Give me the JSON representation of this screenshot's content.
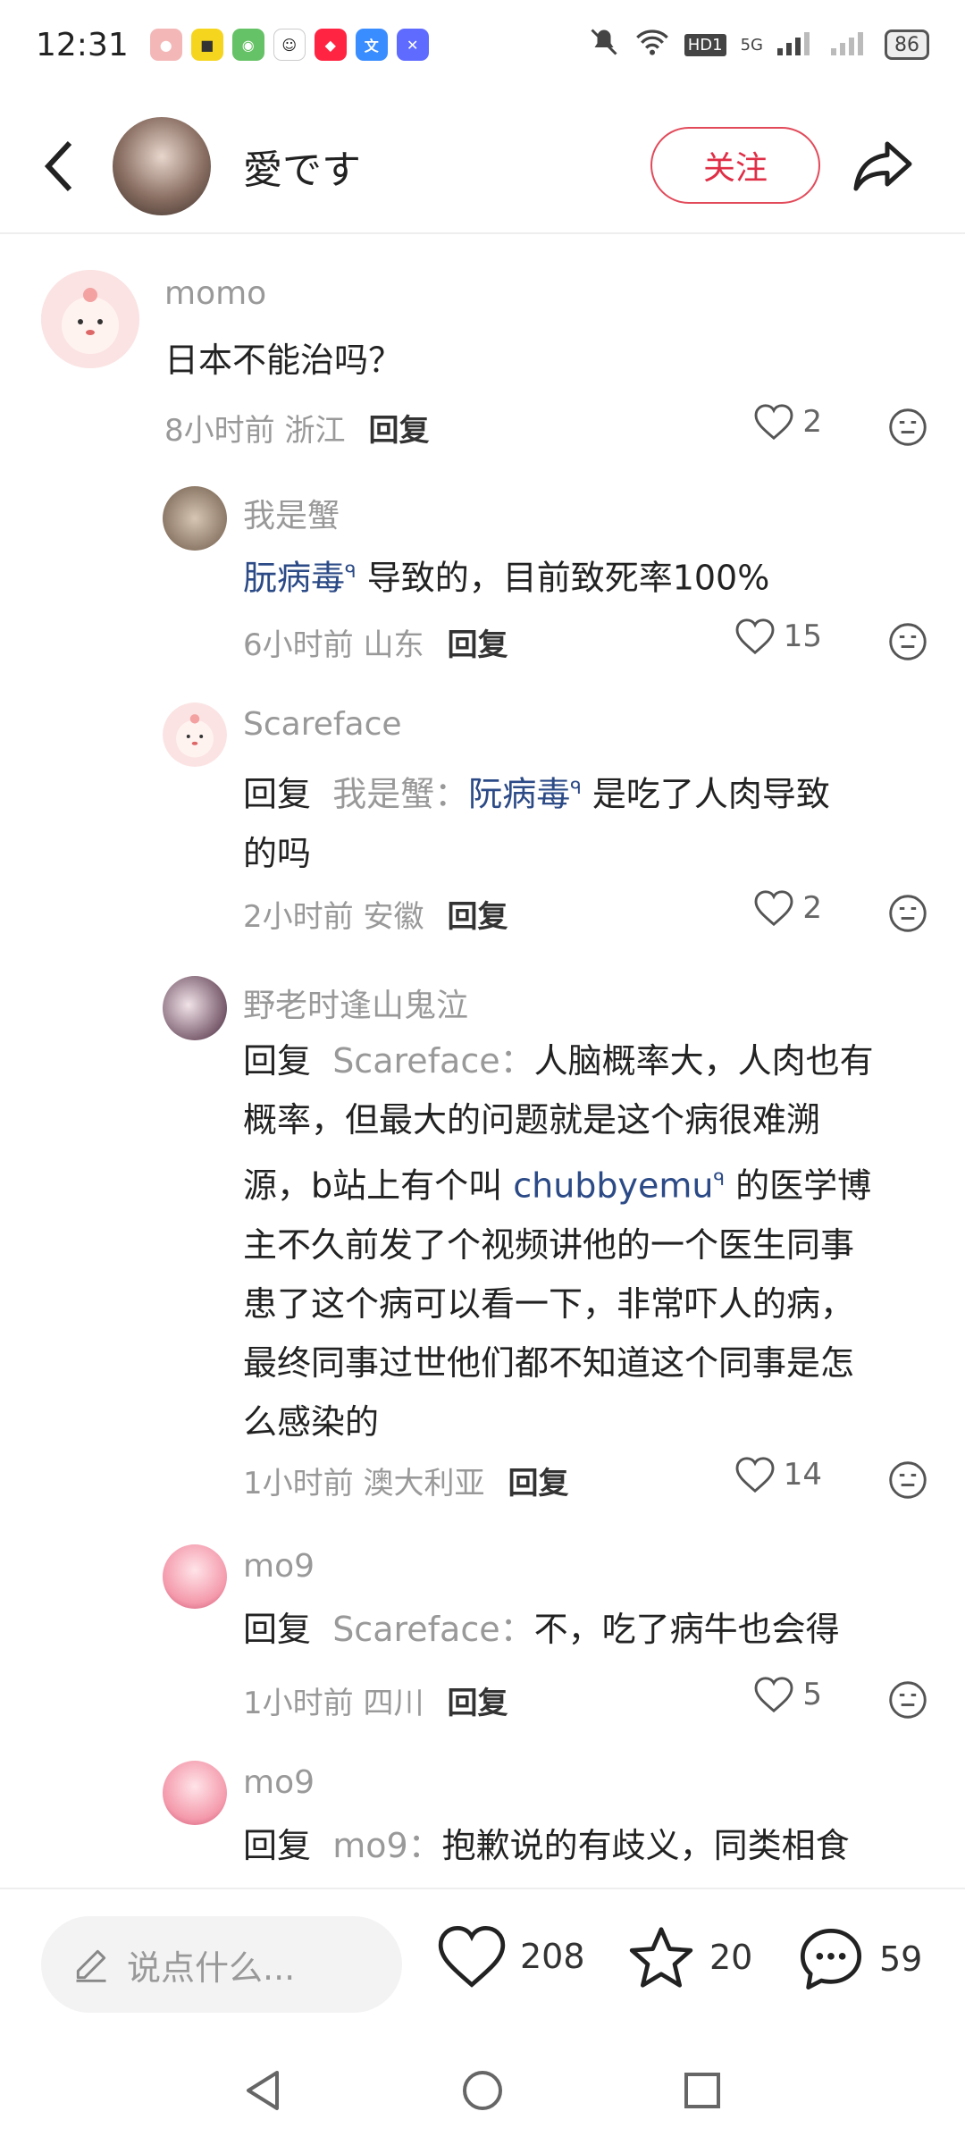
{
  "status_bar": {
    "time": "12:31",
    "network_label": "HD1",
    "signal_label": "5G",
    "battery": "86"
  },
  "header": {
    "username": "愛です",
    "follow_label": "关注"
  },
  "comments": [
    {
      "user": "momo",
      "text": "日本不能治吗？",
      "time": "8小时前",
      "location": "浙江",
      "reply_label": "回复",
      "likes": "2"
    },
    {
      "user": "我是蟹",
      "link_text": "朊病毒",
      "text_after": "导致的，目前致死率100%",
      "time": "6小时前",
      "location": "山东",
      "reply_label": "回复",
      "likes": "15"
    },
    {
      "user": "Scareface",
      "prefix": "回复",
      "reply_to": "我是蟹：",
      "link_text": "阮病毒",
      "text_after_line1": "是吃了人肉导致",
      "text_line2": "的吗",
      "time": "2小时前",
      "location": "安徽",
      "reply_label": "回复",
      "likes": "2"
    },
    {
      "user": "野老时逢山鬼泣",
      "prefix": "回复",
      "reply_to": "Scareface：",
      "line1_rest": "人脑概率大，人肉也有",
      "line2": "概率，但最大的问题就是这个病很难溯",
      "line3_before": "源，b站上有个叫",
      "link_text": "chubbyemu",
      "line3_after": "的医学博",
      "line4": "主不久前发了个视频讲他的一个医生同事",
      "line5": "患了这个病可以看一下，非常吓人的病，",
      "line6": "最终同事过世他们都不知道这个同事是怎",
      "line7": "么感染的",
      "time": "1小时前",
      "location": "澳大利亚",
      "reply_label": "回复",
      "likes": "14"
    },
    {
      "user": "mo9",
      "prefix": "回复",
      "reply_to": "Scareface：",
      "text": "不，吃了病牛也会得",
      "time": "1小时前",
      "location": "四川",
      "reply_label": "回复",
      "likes": "5"
    },
    {
      "user": "mo9",
      "prefix": "回复",
      "reply_to": "mo9：",
      "text": "抱歉说的有歧义，同类相食"
    }
  ],
  "bottom_bar": {
    "placeholder": "说点什么...",
    "likes": "208",
    "stars": "20",
    "comments": "59"
  },
  "colors": {
    "accent": "#e02e46",
    "link": "#2b4a86",
    "muted": "#999999"
  }
}
